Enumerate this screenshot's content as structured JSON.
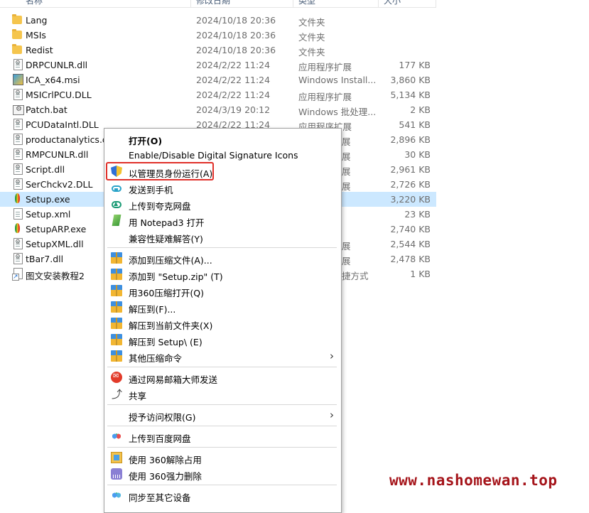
{
  "header": {
    "name": "名称",
    "date": "修改日期",
    "type": "类型",
    "size": "大小"
  },
  "files": [
    {
      "name": "Lang",
      "date": "2024/10/18 20:36",
      "type": "文件夹",
      "size": "",
      "icon": "folder-icon"
    },
    {
      "name": "MSIs",
      "date": "2024/10/18 20:36",
      "type": "文件夹",
      "size": "",
      "icon": "folder-icon"
    },
    {
      "name": "Redist",
      "date": "2024/10/18 20:36",
      "type": "文件夹",
      "size": "",
      "icon": "folder-icon"
    },
    {
      "name": "DRPCUNLR.dll",
      "date": "2024/2/22 11:24",
      "type": "应用程序扩展",
      "size": "177 KB",
      "icon": "dll-file-icon"
    },
    {
      "name": "ICA_x64.msi",
      "date": "2024/2/22 11:24",
      "type": "Windows Install...",
      "size": "3,860 KB",
      "icon": "msi-file-icon"
    },
    {
      "name": "MSICrlPCU.DLL",
      "date": "2024/2/22 11:24",
      "type": "应用程序扩展",
      "size": "5,134 KB",
      "icon": "dll-file-icon"
    },
    {
      "name": "Patch.bat",
      "date": "2024/3/19 20:12",
      "type": "Windows 批处理...",
      "size": "2 KB",
      "icon": "batch-file-icon"
    },
    {
      "name": "PCUDataIntl.DLL",
      "date": "2024/2/22 11:24",
      "type": "应用程序扩展",
      "size": "541 KB",
      "icon": "dll-file-icon"
    },
    {
      "name": "productanalytics.dll",
      "date": "",
      "type": "展",
      "size": "2,896 KB",
      "icon": "dll-file-icon"
    },
    {
      "name": "RMPCUNLR.dll",
      "date": "",
      "type": "展",
      "size": "30 KB",
      "icon": "dll-file-icon"
    },
    {
      "name": "Script.dll",
      "date": "",
      "type": "展",
      "size": "2,961 KB",
      "icon": "dll-file-icon"
    },
    {
      "name": "SerChckv2.DLL",
      "date": "",
      "type": "展",
      "size": "2,726 KB",
      "icon": "dll-file-icon"
    },
    {
      "name": "Setup.exe",
      "date": "",
      "type": "",
      "size": "3,220 KB",
      "icon": "app-icon",
      "selected": true
    },
    {
      "name": "Setup.xml",
      "date": "",
      "type": "",
      "size": "23 KB",
      "icon": "xml-file-icon"
    },
    {
      "name": "SetupARP.exe",
      "date": "",
      "type": "",
      "size": "2,740 KB",
      "icon": "app-icon"
    },
    {
      "name": "SetupXML.dll",
      "date": "",
      "type": "展",
      "size": "2,544 KB",
      "icon": "dll-file-icon"
    },
    {
      "name": "tBar7.dll",
      "date": "",
      "type": "展",
      "size": "2,478 KB",
      "icon": "dll-file-icon"
    },
    {
      "name": "图文安装教程2",
      "date": "",
      "type": "捷方式",
      "size": "1 KB",
      "icon": "shortcut-icon"
    }
  ],
  "menu": {
    "open": "打开(O)",
    "signature": "Enable/Disable Digital Signature Icons",
    "run_as_admin": "以管理员身份运行(A)",
    "send_to_phone": "发送到手机",
    "upload_quark": "上传到夸克网盘",
    "open_notepad3": "用 Notepad3 打开",
    "compat": "兼容性疑难解答(Y)",
    "add_archive": "添加到压缩文件(A)...",
    "add_setup_zip": "添加到 \"Setup.zip\" (T)",
    "open_360zip": "用360压缩打开(Q)",
    "extract_to": "解压到(F)...",
    "extract_here": "解压到当前文件夹(X)",
    "extract_setup": "解压到 Setup\\ (E)",
    "other_compress": "其他压缩命令",
    "netease_send": "通过网易邮箱大师发送",
    "share": "共享",
    "grant_access": "授予访问权限(G)",
    "upload_baidu": "上传到百度网盘",
    "unlock_360": "使用 360解除占用",
    "shred_360": "使用 360强力删除",
    "sync_devices": "同步至其它设备"
  },
  "watermark": "www.nashomewan.top",
  "colors": {
    "selection": "#cce8ff",
    "highlight_border": "#e0302a",
    "watermark": "#a5141a"
  }
}
